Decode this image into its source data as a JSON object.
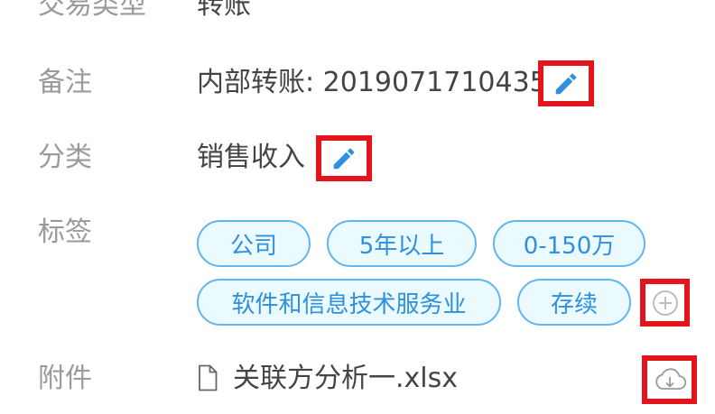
{
  "rows": {
    "type": {
      "label": "交易类型",
      "value": "转账"
    },
    "remark": {
      "label": "备注",
      "value": "内部转账: 20190717104356"
    },
    "category": {
      "label": "分类",
      "value": "销售收入"
    },
    "tags": {
      "label": "标签",
      "items": [
        "公司",
        "5年以上",
        "0-150万",
        "软件和信息技术服务业",
        "存续"
      ]
    },
    "attachment": {
      "label": "附件",
      "file_name": "关联方分析一.xlsx"
    }
  },
  "icons": {
    "remark_edit": "pencil-icon",
    "category_edit": "pencil-icon",
    "add_tag": "plus-circle-icon",
    "file": "file-icon",
    "download": "cloud-download-icon"
  },
  "colors": {
    "label": "#9a9a9a",
    "value": "#444444",
    "accent": "#2f8fe0",
    "tag_border": "#62b6ef",
    "tag_fill": "#eafaff",
    "highlight": "#e3141b"
  }
}
